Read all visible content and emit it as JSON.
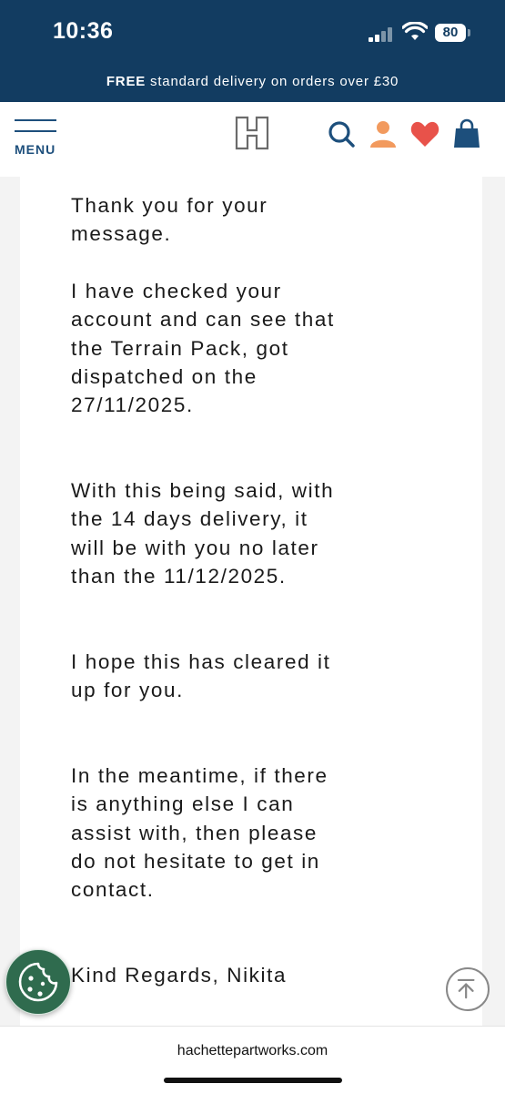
{
  "status_bar": {
    "time": "10:36",
    "battery": "80"
  },
  "promo": {
    "bold": "FREE",
    "text": " standard delivery on orders over £30"
  },
  "header": {
    "menu_label": "MENU"
  },
  "message": {
    "paragraphs": [
      "Thank you for your message.",
      "I have checked your account and can see that the Terrain Pack, got dispatched on the 27/11/2025.",
      "With this being said, with the 14 days delivery, it will be with you no later than the 11/12/2025.",
      "I hope this has cleared it up for you.",
      "In the meantime, if there is anything else I can assist with, then please do not hesitate to get in contact.",
      "Kind Regards, Nikita"
    ]
  },
  "footer": {
    "url": "hachettepartworks.com"
  },
  "colors": {
    "navy": "#123c61",
    "accent_orange": "#f29a5e",
    "heart_red": "#e8524a",
    "cookie_green": "#2f6b4e"
  },
  "icons": [
    "search-icon",
    "account-icon",
    "wishlist-heart-icon",
    "shopping-bag-icon",
    "cookie-icon",
    "back-to-top-icon"
  ]
}
